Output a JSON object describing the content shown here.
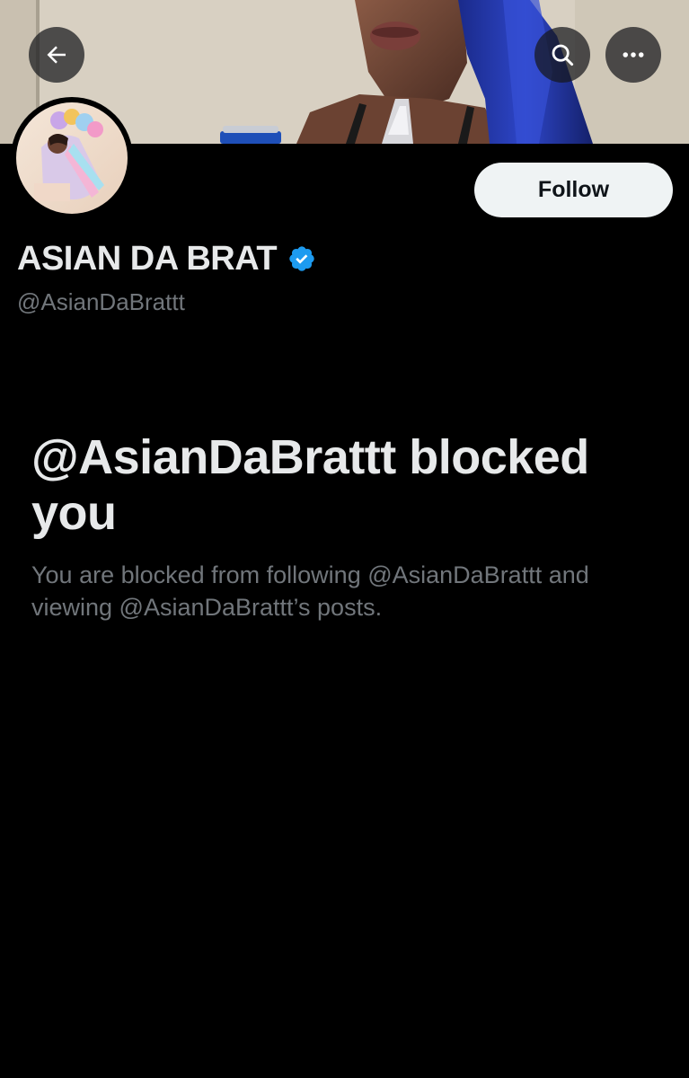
{
  "header": {
    "back_icon": "arrow-left-icon",
    "search_icon": "search-icon",
    "more_icon": "more-horizontal-icon"
  },
  "profile": {
    "display_name": "ASIAN DA BRAT",
    "handle": "@AsianDaBrattt",
    "verified": true,
    "verified_color": "#1d9bf0"
  },
  "actions": {
    "follow_label": "Follow"
  },
  "blocked": {
    "title": "@AsianDaBrattt blocked you",
    "description": "You are blocked from following @AsianDaBrattt and viewing @AsianDaBrattt’s posts."
  },
  "colors": {
    "background": "#000000",
    "primary_text": "#e7e9ea",
    "secondary_text": "#71767b",
    "button_bg": "#eff3f4"
  }
}
